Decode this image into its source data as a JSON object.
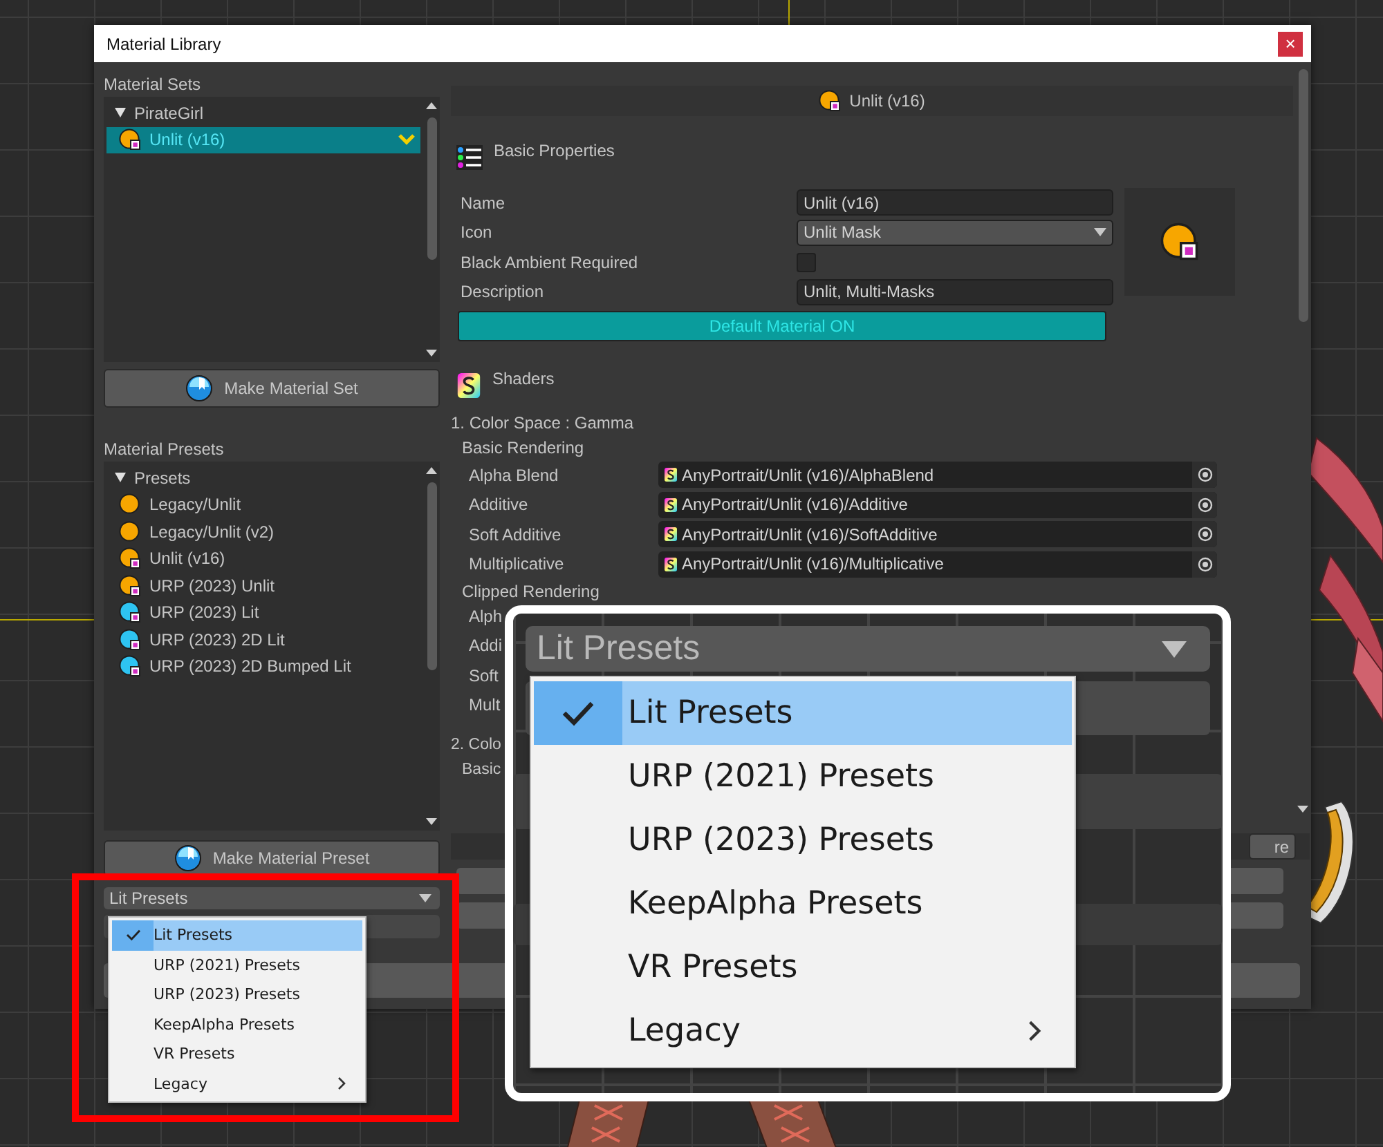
{
  "window": {
    "title": "Material Library",
    "close": "×"
  },
  "material_sets": {
    "heading": "Material Sets",
    "tree": [
      {
        "label": "PirateGirl",
        "expanded": true,
        "children": [
          {
            "label": "Unlit (v16)",
            "kind": "unlit",
            "selected": true
          }
        ]
      }
    ],
    "button": "Make Material Set"
  },
  "material_presets": {
    "heading": "Material Presets",
    "tree": [
      {
        "label": "Presets",
        "expanded": true,
        "children": [
          {
            "label": "Legacy/Unlit",
            "kind": "legacy",
            "selected": false
          },
          {
            "label": "Legacy/Unlit (v2)",
            "kind": "legacy",
            "selected": false
          },
          {
            "label": "Unlit (v16)",
            "kind": "unlit",
            "selected": false
          },
          {
            "label": "URP (2023) Unlit",
            "kind": "unlit",
            "selected": false
          },
          {
            "label": "URP (2023) Lit",
            "kind": "lit",
            "selected": false
          },
          {
            "label": "URP (2023) 2D Lit",
            "kind": "lit",
            "selected": false
          },
          {
            "label": "URP (2023) 2D Bumped Lit",
            "kind": "lit",
            "selected": false
          }
        ]
      }
    ],
    "button": "Make Material Preset",
    "dropdown": "Lit Presets"
  },
  "preset_menu": {
    "items": [
      {
        "label": "Lit Presets",
        "selected": true,
        "submenu": false
      },
      {
        "label": "URP (2021) Presets",
        "selected": false,
        "submenu": false
      },
      {
        "label": "URP (2023) Presets",
        "selected": false,
        "submenu": false
      },
      {
        "label": "KeepAlpha Presets",
        "selected": false,
        "submenu": false
      },
      {
        "label": "VR Presets",
        "selected": false,
        "submenu": false
      },
      {
        "label": "Legacy",
        "selected": false,
        "submenu": true
      }
    ]
  },
  "properties": {
    "header": "Unlit (v16)",
    "basic_heading": "Basic Properties",
    "fields": [
      {
        "label": "Name",
        "kind": "text",
        "value": "Unlit (v16)"
      },
      {
        "label": "Icon",
        "kind": "dropdown",
        "value": "Unlit Mask"
      },
      {
        "label": "Black Ambient Required",
        "kind": "checkbox",
        "checked": false
      },
      {
        "label": "Description",
        "kind": "text",
        "value": "Unlit, Multi-Masks"
      }
    ],
    "default_button": {
      "label": "Default Material ON",
      "on": true
    },
    "shaders_heading": "Shaders",
    "color_space": "1. Color Space : Gamma",
    "groups": [
      {
        "title": "Basic Rendering",
        "rows": [
          {
            "label": "Alpha Blend",
            "value": "AnyPortrait/Unlit (v16)/AlphaBlend"
          },
          {
            "label": "Additive",
            "value": "AnyPortrait/Unlit (v16)/Additive"
          },
          {
            "label": "Soft Additive",
            "value": "AnyPortrait/Unlit (v16)/SoftAdditive"
          },
          {
            "label": "Multiplicative",
            "value": "AnyPortrait/Unlit (v16)/Multiplicative"
          }
        ]
      },
      {
        "title": "Clipped Rendering",
        "rows": [
          {
            "label": "Alph"
          },
          {
            "label": "Addi"
          },
          {
            "label": "Soft"
          },
          {
            "label": "Mult"
          }
        ]
      }
    ],
    "color_space_2": "2. Colo",
    "group_2_title": "Basic",
    "partial_button": "re"
  },
  "callout": {
    "dropdown": "Lit Presets",
    "items": [
      {
        "label": "Lit Presets",
        "selected": true,
        "submenu": false
      },
      {
        "label": "URP (2021) Presets",
        "selected": false,
        "submenu": false
      },
      {
        "label": "URP (2023) Presets",
        "selected": false,
        "submenu": false
      },
      {
        "label": "KeepAlpha Presets",
        "selected": false,
        "submenu": false
      },
      {
        "label": "VR Presets",
        "selected": false,
        "submenu": false
      },
      {
        "label": "Legacy",
        "selected": false,
        "submenu": true
      }
    ]
  }
}
